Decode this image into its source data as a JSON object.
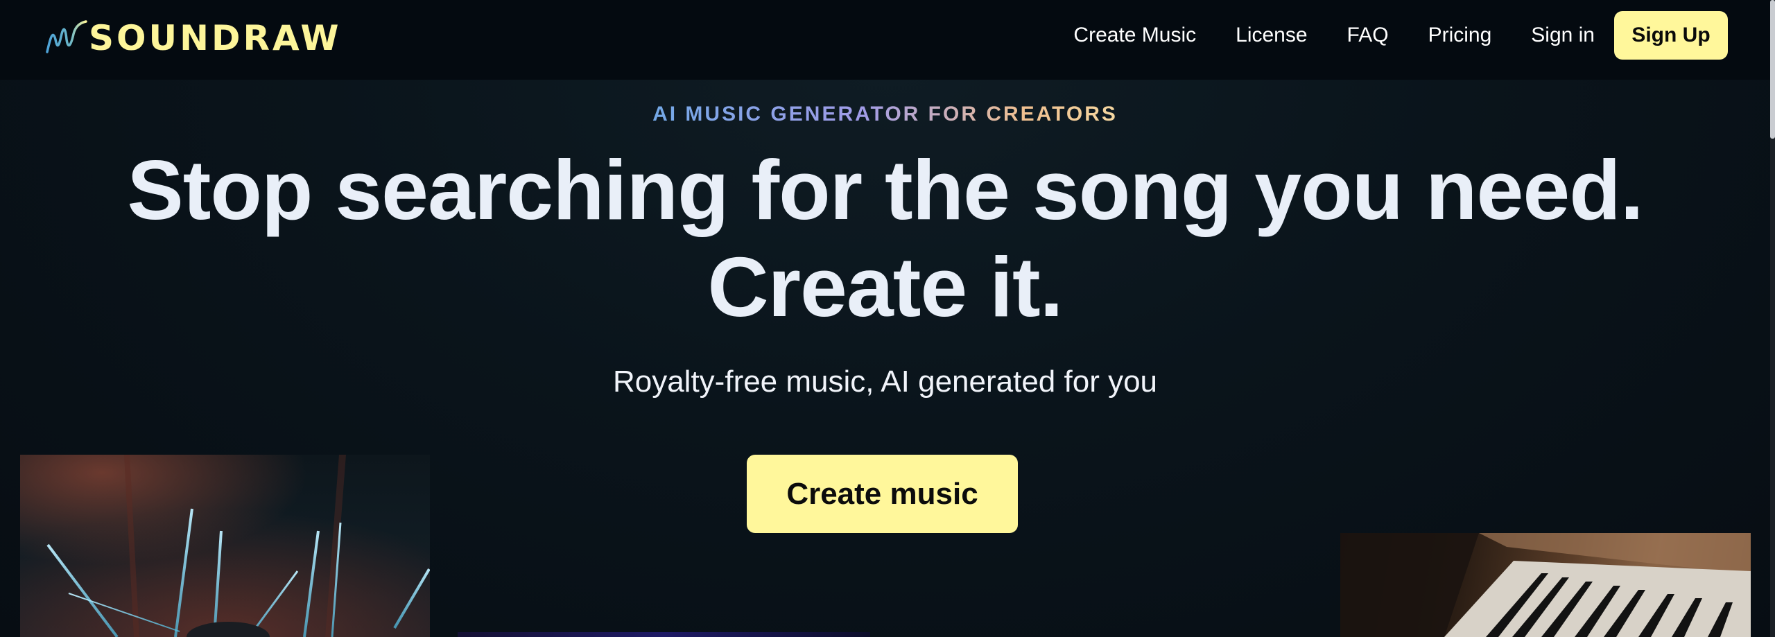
{
  "brand": {
    "name": "SOUNDRAW",
    "accent_color": "#fff79b"
  },
  "nav": {
    "links": [
      "Create Music",
      "License",
      "FAQ",
      "Pricing",
      "Sign in"
    ],
    "signup_label": "Sign Up"
  },
  "hero": {
    "eyebrow": "AI MUSIC GENERATOR FOR CREATORS",
    "headline_line1": "Stop searching for the song you need.",
    "headline_line2": "Create it.",
    "subhead": "Royalty-free music, AI generated for you",
    "cta_label": "Create music"
  },
  "images": [
    {
      "name": "concert-stage-lights"
    },
    {
      "name": "abstract-blue-purple"
    },
    {
      "name": "piano-keys"
    }
  ]
}
